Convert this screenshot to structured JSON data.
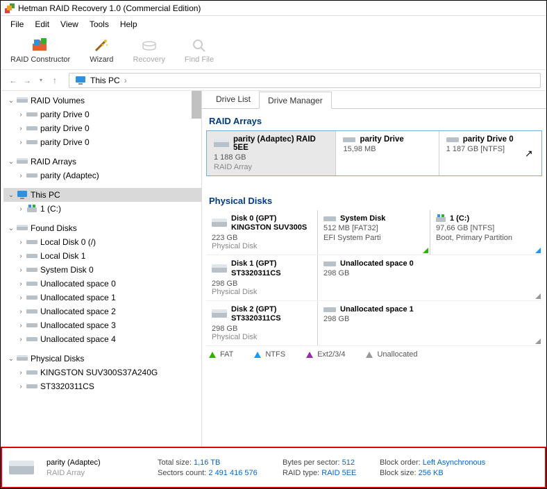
{
  "window": {
    "title": "Hetman RAID Recovery 1.0 (Commercial Edition)"
  },
  "menu": {
    "file": "File",
    "edit": "Edit",
    "view": "View",
    "tools": "Tools",
    "help": "Help"
  },
  "toolbar": {
    "raid": "RAID Constructor",
    "wizard": "Wizard",
    "recovery": "Recovery",
    "find": "Find File"
  },
  "breadcrumb": {
    "location": "This PC",
    "sep": "›"
  },
  "tree": {
    "raid_volumes": "RAID Volumes",
    "pd0": "parity Drive 0",
    "raid_arrays": "RAID Arrays",
    "parity_adaptec": "parity (Adaptec)",
    "this_pc": "This PC",
    "c1": "1 (C:)",
    "found_disks": "Found Disks",
    "local0": "Local Disk 0 (/)",
    "local1": "Local Disk 1",
    "sys0": "System Disk 0",
    "un0": "Unallocated space 0",
    "un1": "Unallocated space 1",
    "un2": "Unallocated space 2",
    "un3": "Unallocated space 3",
    "un4": "Unallocated space 4",
    "physical_disks": "Physical Disks",
    "kingston": "KINGSTON SUV300S37A240G",
    "st": "ST3320311CS"
  },
  "tabs": {
    "drive_list": "Drive List",
    "drive_manager": "Drive Manager"
  },
  "sections": {
    "raid_arrays": "RAID Arrays",
    "physical_disks": "Physical Disks"
  },
  "raid_cards": [
    {
      "name": "parity (Adaptec) RAID 5EE",
      "size": "1 188 GB",
      "type": "RAID Array"
    },
    {
      "name": "parity Drive",
      "size": "15,98 MB"
    },
    {
      "name": "parity Drive 0",
      "size": "1 187 GB [NTFS]"
    }
  ],
  "disks": [
    {
      "name": "Disk 0 (GPT)",
      "model": "KINGSTON SUV300S",
      "size": "223 GB",
      "type": "Physical Disk",
      "parts": [
        {
          "name": "System Disk",
          "det1": "512 MB [FAT32]",
          "det2": "EFI System Parti",
          "color": "#2db300"
        },
        {
          "name": "1 (C:)",
          "det1": "97,66 GB [NTFS]",
          "det2": "Boot, Primary Partition",
          "color": "#2196f3",
          "icon": "c"
        }
      ]
    },
    {
      "name": "Disk 1 (GPT)",
      "model": "ST3320311CS",
      "size": "298 GB",
      "type": "Physical Disk",
      "parts": [
        {
          "name": "Unallocated space 0",
          "det1": "298 GB",
          "color": "#999"
        }
      ]
    },
    {
      "name": "Disk 2 (GPT)",
      "model": "ST3320311CS",
      "size": "298 GB",
      "type": "Physical Disk",
      "parts": [
        {
          "name": "Unallocated space 1",
          "det1": "298 GB",
          "color": "#999"
        }
      ]
    }
  ],
  "legend": {
    "fat": "FAT",
    "ntfs": "NTFS",
    "ext": "Ext2/3/4",
    "unalloc": "Unallocated"
  },
  "status": {
    "name": "parity (Adaptec)",
    "type": "RAID Array",
    "total_size_k": "Total size:",
    "total_size_v": "1,16 TB",
    "sectors_k": "Sectors count:",
    "sectors_v": "2 491 416 576",
    "bps_k": "Bytes per sector:",
    "bps_v": "512",
    "rtype_k": "RAID type:",
    "rtype_v": "RAID 5EE",
    "border_k": "Block order:",
    "border_v": "Left Asynchronous",
    "bsize_k": "Block size:",
    "bsize_v": "256 KB"
  }
}
